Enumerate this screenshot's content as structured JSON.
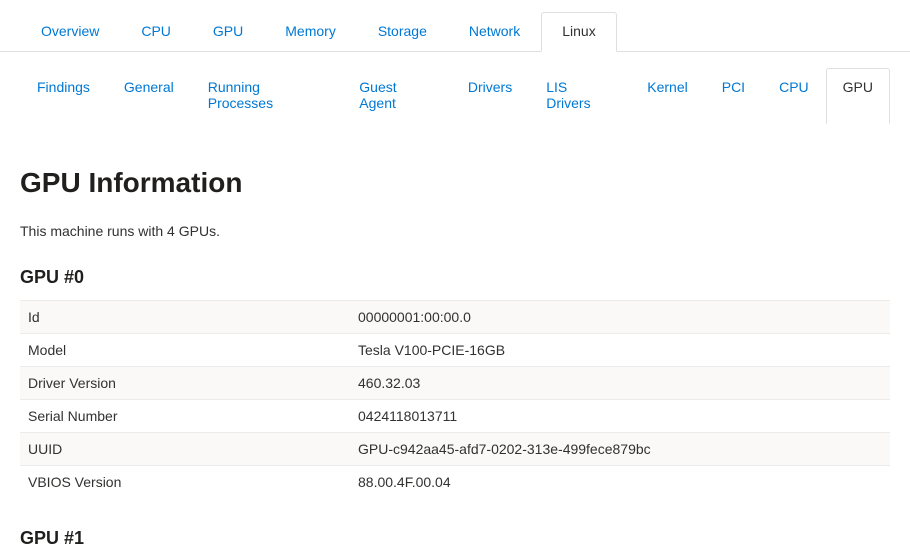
{
  "primaryTabs": [
    {
      "label": "Overview",
      "active": false,
      "name": "tab-overview"
    },
    {
      "label": "CPU",
      "active": false,
      "name": "tab-cpu"
    },
    {
      "label": "GPU",
      "active": false,
      "name": "tab-gpu"
    },
    {
      "label": "Memory",
      "active": false,
      "name": "tab-memory"
    },
    {
      "label": "Storage",
      "active": false,
      "name": "tab-storage"
    },
    {
      "label": "Network",
      "active": false,
      "name": "tab-network"
    },
    {
      "label": "Linux",
      "active": true,
      "name": "tab-linux"
    }
  ],
  "secondaryTabs": [
    {
      "label": "Findings",
      "active": false,
      "name": "subtab-findings"
    },
    {
      "label": "General",
      "active": false,
      "name": "subtab-general"
    },
    {
      "label": "Running Processes",
      "active": false,
      "name": "subtab-running-processes"
    },
    {
      "label": "Guest Agent",
      "active": false,
      "name": "subtab-guest-agent"
    },
    {
      "label": "Drivers",
      "active": false,
      "name": "subtab-drivers"
    },
    {
      "label": "LIS Drivers",
      "active": false,
      "name": "subtab-lis-drivers"
    },
    {
      "label": "Kernel",
      "active": false,
      "name": "subtab-kernel"
    },
    {
      "label": "PCI",
      "active": false,
      "name": "subtab-pci"
    },
    {
      "label": "CPU",
      "active": false,
      "name": "subtab-cpu"
    },
    {
      "label": "GPU",
      "active": true,
      "name": "subtab-gpu"
    }
  ],
  "heading": "GPU Information",
  "subtitle": "This machine runs with 4 GPUs.",
  "gpu0": {
    "title": "GPU #0",
    "rows": [
      {
        "key": "Id",
        "value": "00000001:00:00.0"
      },
      {
        "key": "Model",
        "value": "Tesla V100-PCIE-16GB"
      },
      {
        "key": "Driver Version",
        "value": "460.32.03"
      },
      {
        "key": "Serial Number",
        "value": "0424118013711"
      },
      {
        "key": "UUID",
        "value": "GPU-c942aa45-afd7-0202-313e-499fece879bc"
      },
      {
        "key": "VBIOS Version",
        "value": "88.00.4F.00.04"
      }
    ]
  },
  "gpu1": {
    "title": "GPU #1"
  }
}
